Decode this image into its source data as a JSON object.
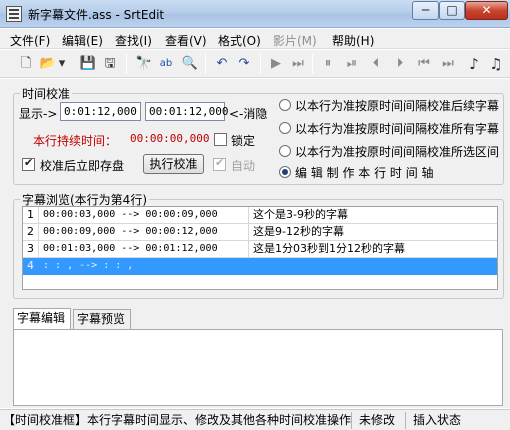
{
  "window": {
    "title": "新字幕文件.ass - SrtEdit",
    "min": "─",
    "max": "□",
    "close": "✕"
  },
  "menu": [
    {
      "label": "文件(F)",
      "disabled": false
    },
    {
      "label": "编辑(E)",
      "disabled": false
    },
    {
      "label": "查找(I)",
      "disabled": false
    },
    {
      "label": "查看(V)",
      "disabled": false
    },
    {
      "label": "格式(O)",
      "disabled": false
    },
    {
      "label": "影片(M)",
      "disabled": true
    },
    {
      "label": "帮助(H)",
      "disabled": false
    }
  ],
  "toolbar": {
    "icons": [
      "new-file-icon",
      "open-folder-icon",
      "dropdown-arrow-icon",
      "save-icon",
      "save-all-icon",
      "binoculars-find-icon",
      "replace-ab-icon",
      "find-in-file-icon",
      "undo-icon",
      "redo-icon",
      "play-icon",
      "step-icon",
      "pause-icon",
      "next-frame-icon",
      "rewind-icon",
      "forward-icon",
      "skip-back-icon",
      "skip-forward-icon",
      "music-note-icon",
      "music-note-2-icon"
    ],
    "glyphs": {
      "new": "🗋",
      "open": "📂",
      "drop": "▾",
      "save": "💾",
      "saveall": "🖫",
      "find": "🔭",
      "replace": "ab",
      "findfile": "🔍",
      "undo": "↶",
      "redo": "↷",
      "play": "▶",
      "step": "⏭",
      "pause": "⏸",
      "next": "⏯",
      "rew": "⏴",
      "fwd": "⏵",
      "skipb": "⏮",
      "skipf": "⏭",
      "note1": "♪",
      "note2": "♫"
    }
  },
  "time_group": {
    "title": "时间校准",
    "display_label": "显示->",
    "start_value": "0:01:12,000",
    "end_value": "00:01:12,000",
    "cancel_label": "<-消隐",
    "duration_label": "本行持续时间：",
    "duration_value": "00:00:00,000",
    "lock_label": "锁定",
    "lock_checked": false,
    "apply_now_label": "校准后立即存盘",
    "apply_now_checked": true,
    "execute_button": "执行校准",
    "auto_label": "自动",
    "auto_checked": true,
    "radio_options": [
      {
        "label": "以本行为准按原时间间隔校准后续字幕",
        "selected": false
      },
      {
        "label": "以本行为准按原时间间隔校准所有字幕",
        "selected": false
      },
      {
        "label": "以本行为准按原时间间隔校准所选区间",
        "selected": false
      },
      {
        "label": "编 辑 制 作 本 行 时 间 轴",
        "selected": true
      }
    ]
  },
  "browse_group": {
    "title": "字幕浏览(本行为第4行)",
    "rows": [
      {
        "num": "1",
        "time": "00:00:03,000 --> 00:00:09,000",
        "text": "这个是3-9秒的字幕",
        "selected": false
      },
      {
        "num": "2",
        "time": "00:00:09,000 --> 00:00:12,000",
        "text": "这是9-12秒的字幕",
        "selected": false
      },
      {
        "num": "3",
        "time": "00:01:03,000 --> 00:01:12,000",
        "text": "这是1分03秒到1分12秒的字幕",
        "selected": false
      },
      {
        "num": "4",
        "time": "  :  :  ,     -->   :  :  ,",
        "text": "",
        "selected": true
      }
    ]
  },
  "tabs": [
    {
      "label": "字幕编辑",
      "active": true
    },
    {
      "label": "字幕预览",
      "active": false
    }
  ],
  "status": {
    "hint": "【时间校准框】本行字幕时间显示、修改及其他各种时间校准操作",
    "modified": "未修改",
    "mode": "插入状态"
  }
}
